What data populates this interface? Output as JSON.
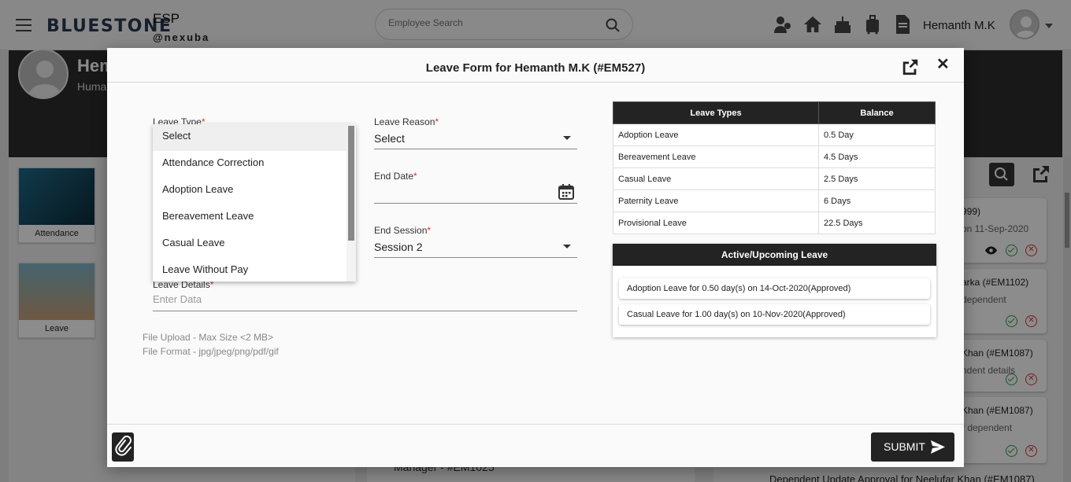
{
  "app": {
    "brand": "BLUESTONE",
    "module": "ESP",
    "org": "@nexuba"
  },
  "navbar": {
    "search_placeholder": "Employee Search",
    "user_name": "Hemanth M.K",
    "icons": [
      "team-icon",
      "home-icon",
      "birthday-cake-icon",
      "luggage-icon",
      "document-icon"
    ]
  },
  "background": {
    "profile_name": "Hem",
    "profile_role": "Huma",
    "tiles": [
      "Attendance",
      "Leave"
    ],
    "right_cards": [
      {
        "t1": "999)",
        "t2": "on 11-Sep-2020"
      },
      {
        "t1": "arka (#EM1102)",
        "t2": "dependent"
      },
      {
        "t1": "Khan (#EM1087)",
        "t2": "ndent details"
      },
      {
        "t1": "Khan (#EM1087)",
        "t2": "r dependent"
      }
    ],
    "mid_text": "Manager - #EM1025",
    "bottom_right_text": "Dependent Update Approval for Neelufar Khan (#EM1087)"
  },
  "modal": {
    "title": "Leave Form for Hemanth M.K (#EM527)",
    "form": {
      "leave_type_label": "Leave Type",
      "leave_reason_label": "Leave Reason",
      "leave_reason_value": "Select",
      "end_date_label": "End Date",
      "end_session_label": "End Session",
      "end_session_value": "Session 2",
      "leave_details_label": "Leave Details",
      "leave_details_placeholder": "Enter Data",
      "required_mark": "*"
    },
    "leave_type_options": [
      "Select",
      "Attendance Correction",
      "Adoption Leave",
      "Bereavement Leave",
      "Casual Leave",
      "Leave Without Pay"
    ],
    "file_upload": {
      "max_size": "File Upload - Max Size <2 MB>",
      "format": "File Format -   jpg/jpeg/png/pdf/gif"
    },
    "balance_table": {
      "headers": [
        "Leave Types",
        "Balance"
      ],
      "rows": [
        [
          "Adoption Leave",
          "0.5 Day"
        ],
        [
          "Bereavement Leave",
          "4.5 Days"
        ],
        [
          "Casual Leave",
          "2.5 Days"
        ],
        [
          "Paternity Leave",
          "6 Days"
        ],
        [
          "Provisional Leave",
          "22.5 Days"
        ]
      ]
    },
    "active_leave": {
      "title": "Active/Upcoming Leave",
      "items": [
        "Adoption Leave for 0.50 day(s) on 14-Oct-2020(Approved)",
        "Casual Leave for 1.00 day(s) on 10-Nov-2020(Approved)"
      ]
    },
    "submit_label": "SUBMIT"
  }
}
